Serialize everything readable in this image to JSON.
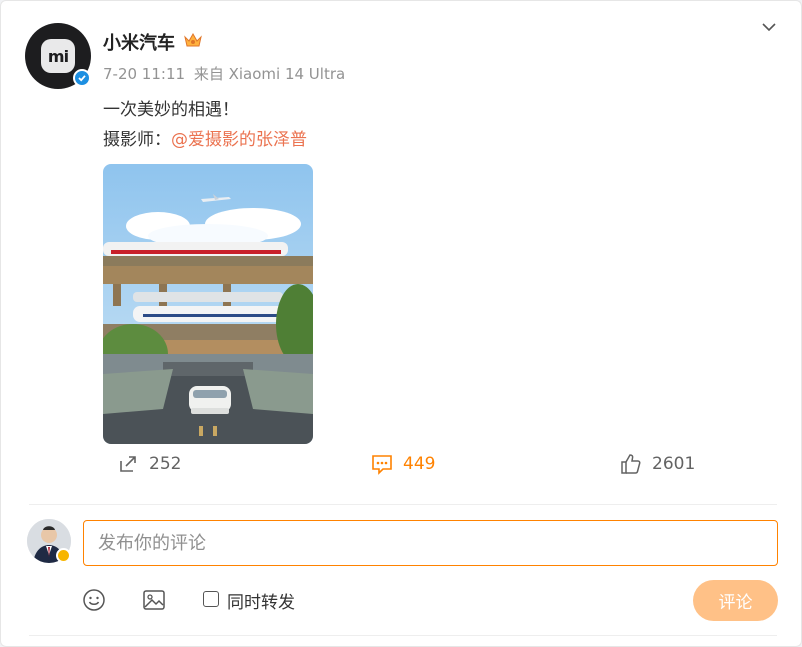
{
  "post": {
    "author": "小米汽车",
    "avatar_logo_text": "mi",
    "timestamp": "7-20 11:11",
    "source": "来自 Xiaomi 14 Ultra",
    "text_line1": "一次美妙的相遇！",
    "text_line2_prefix": "摄影师：",
    "mention": "@爱摄影的张泽普",
    "image_alt": "Photo of a white car on a road beneath railway bridges with high-speed trains and an airplane overhead"
  },
  "actions": {
    "repost_count": "252",
    "comment_count": "449",
    "like_count": "2601"
  },
  "composer": {
    "placeholder": "发布你的评论",
    "repost_label": "同时转发",
    "submit_label": "评论"
  },
  "icons": {
    "verified": "verified-badge-icon",
    "crown": "crown-icon",
    "chevron": "chevron-down-icon",
    "repost": "repost-icon",
    "comment": "comment-icon",
    "like": "like-icon",
    "emoji": "emoji-icon",
    "image": "image-icon"
  },
  "colors": {
    "accent": "#ff8200",
    "mention": "#eb7350",
    "verified": "#1d8fe1",
    "submit_disabled": "#ffc187"
  }
}
